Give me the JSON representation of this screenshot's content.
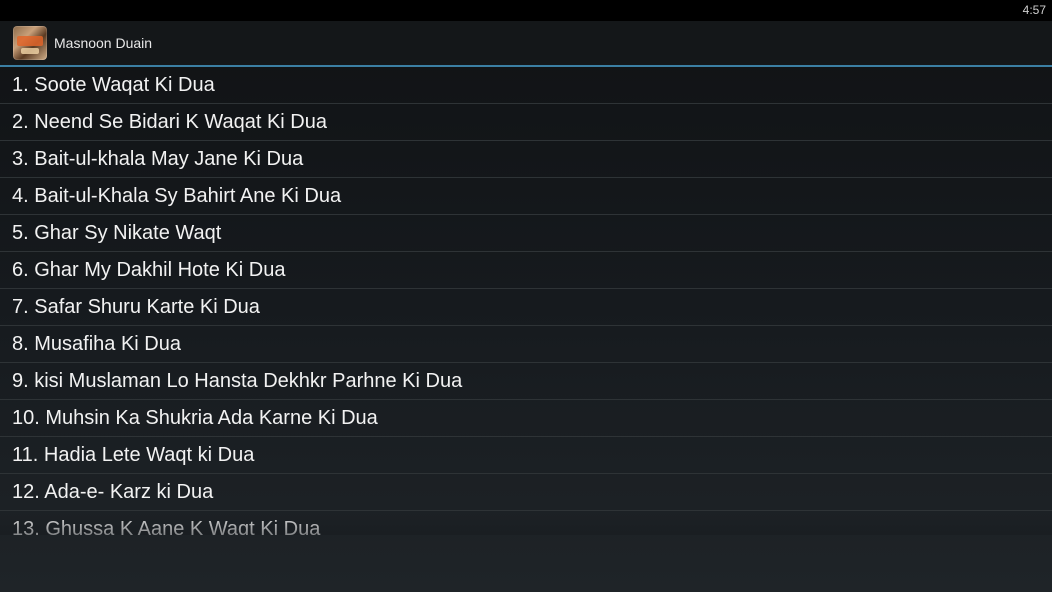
{
  "status_bar": {
    "time": "4:57"
  },
  "action_bar": {
    "app_icon": "app-logo-icon",
    "title": "Masnoon Duain"
  },
  "list": {
    "items": [
      "1. Soote Waqat Ki Dua",
      "2. Neend Se Bidari K Waqat Ki Dua",
      "3. Bait-ul-khala May Jane Ki Dua",
      "4. Bait-ul-Khala Sy Bahirt Ane Ki Dua",
      "5. Ghar Sy Nikate Waqt",
      "6. Ghar My Dakhil Hote Ki Dua",
      "7. Safar Shuru Karte Ki Dua",
      "8. Musafiha Ki Dua",
      "9. kisi Muslaman Lo Hansta Dekhkr Parhne Ki Dua",
      "10. Muhsin Ka Shukria Ada Karne Ki Dua",
      "11. Hadia Lete Waqt ki Dua",
      "12. Ada-e- Karz ki Dua",
      "13. Ghussa K Aane K Waqt Ki Dua"
    ]
  },
  "colors": {
    "accent": "#3b7fa3",
    "background": "#161a1e",
    "text": "#f2f2f2"
  }
}
